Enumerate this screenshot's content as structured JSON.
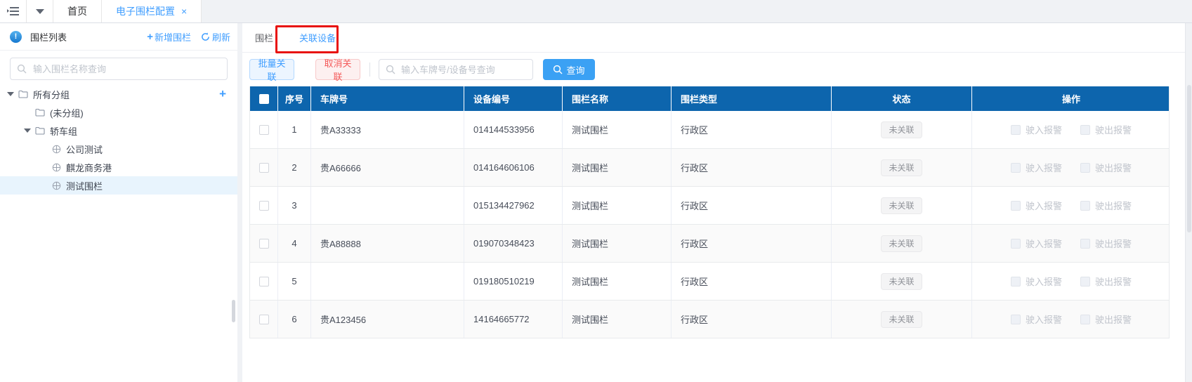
{
  "colors": {
    "accent_blue": "#409eff",
    "header_blue": "#0d65ad",
    "danger_red": "#f45c5c",
    "annotation_red": "#e8120e",
    "status_gray": "#909399",
    "page_bg": "#f0f2f5"
  },
  "topbar": {
    "tabs": [
      {
        "label": "首页",
        "active": false,
        "closable": false
      },
      {
        "label": "电子围栏配置",
        "active": true,
        "closable": true
      }
    ],
    "close_glyph": "×"
  },
  "sidebar": {
    "title": "围栏列表",
    "add_fence_label": "新增围栏",
    "refresh_label": "刷新",
    "search_placeholder": "输入围栏名称查询",
    "tree": [
      {
        "label": "所有分组",
        "level": 0,
        "icon": "folder",
        "caret": true,
        "add_button": true,
        "selected": false
      },
      {
        "label": "(未分组)",
        "level": 1,
        "icon": "folder",
        "caret": false,
        "add_button": false,
        "selected": false
      },
      {
        "label": "轿车组",
        "level": 1,
        "icon": "folder",
        "caret": true,
        "add_button": false,
        "selected": false
      },
      {
        "label": "公司测试",
        "level": 2,
        "icon": "fence",
        "caret": false,
        "add_button": false,
        "selected": false
      },
      {
        "label": "麒龙商务港",
        "level": 2,
        "icon": "fence",
        "caret": false,
        "add_button": false,
        "selected": false
      },
      {
        "label": "测试围栏",
        "level": 2,
        "icon": "fence",
        "caret": false,
        "add_button": false,
        "selected": true
      }
    ]
  },
  "main": {
    "tabs": [
      {
        "label": "围栏",
        "active": false,
        "annotated": false
      },
      {
        "label": "关联设备",
        "active": true,
        "annotated": true
      }
    ],
    "toolbar": {
      "batch_link_label": "批量关联",
      "unlink_label": "取消关联",
      "search_placeholder": "输入车牌号/设备号查询",
      "query_label": "查询"
    },
    "table": {
      "columns": [
        "序号",
        "车牌号",
        "设备编号",
        "围栏名称",
        "围栏类型",
        "状态",
        "操作"
      ],
      "enter_alarm_label": "驶入报警",
      "exit_alarm_label": "驶出报警",
      "rows": [
        {
          "index": "1",
          "plate": "贵A33333",
          "device": "014144533956",
          "fence": "测试围栏",
          "type": "行政区",
          "status": "未关联"
        },
        {
          "index": "2",
          "plate": "贵A66666",
          "device": "014164606106",
          "fence": "测试围栏",
          "type": "行政区",
          "status": "未关联"
        },
        {
          "index": "3",
          "plate": "",
          "device": "015134427962",
          "fence": "测试围栏",
          "type": "行政区",
          "status": "未关联"
        },
        {
          "index": "4",
          "plate": "贵A88888",
          "device": "019070348423",
          "fence": "测试围栏",
          "type": "行政区",
          "status": "未关联"
        },
        {
          "index": "5",
          "plate": "",
          "device": "019180510219",
          "fence": "测试围栏",
          "type": "行政区",
          "status": "未关联"
        },
        {
          "index": "6",
          "plate": "贵A123456",
          "device": "14164665772",
          "fence": "测试围栏",
          "type": "行政区",
          "status": "未关联"
        }
      ]
    }
  }
}
